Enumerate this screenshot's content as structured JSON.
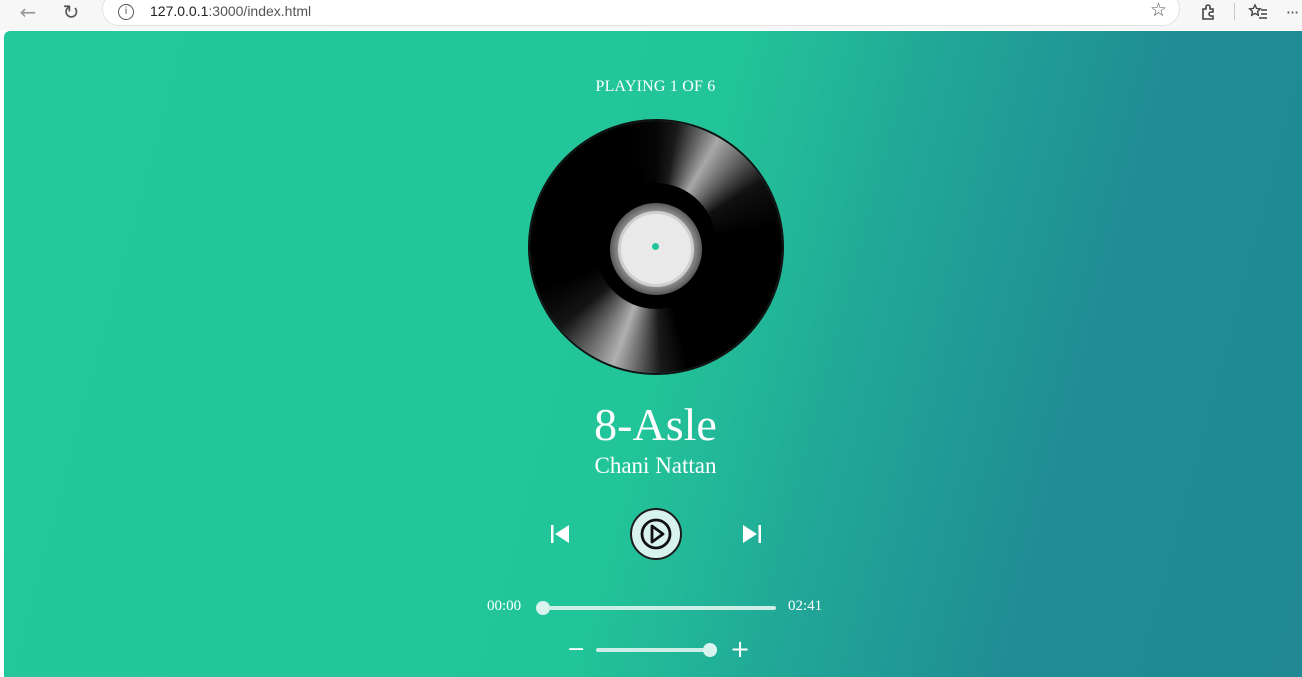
{
  "browser": {
    "url_host": "127.0.0.1",
    "url_path": ":3000/index.html",
    "icons": {
      "back": "back-arrow-icon",
      "reload": "reload-icon",
      "info": "info-icon",
      "star": "star-icon",
      "extensions": "puzzle-icon",
      "favorites": "favorites-icon",
      "more": "more-icon"
    }
  },
  "player": {
    "status": "PLAYING 1 OF 6",
    "title": "8-Asle",
    "artist": "Chani Nattan",
    "current_time": "00:00",
    "duration": "02:41",
    "progress_fraction": 0.0,
    "volume_fraction": 0.95,
    "volume_minus_label": "−",
    "volume_plus_label": "+",
    "accent_color": "#23c89c",
    "gradient_end_color": "#208994"
  }
}
